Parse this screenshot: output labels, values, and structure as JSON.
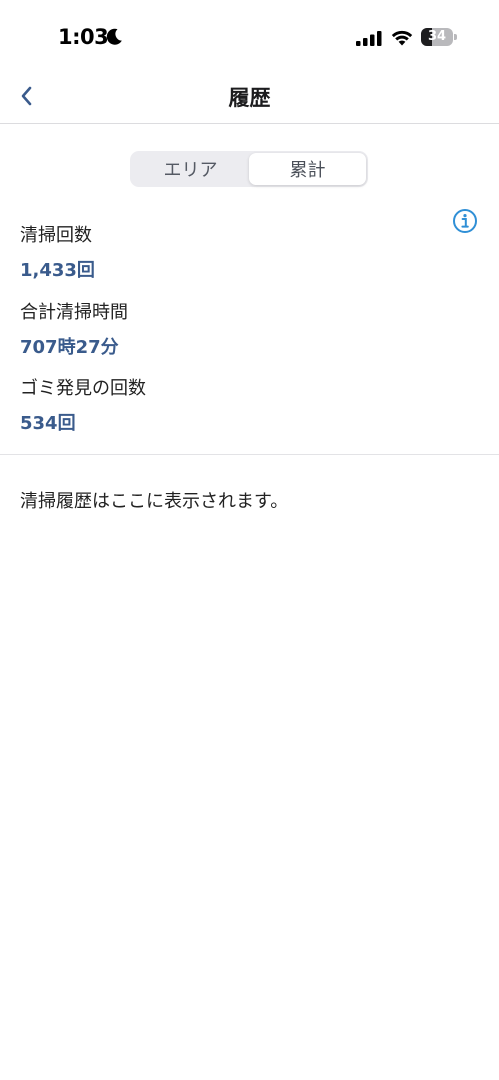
{
  "status_bar": {
    "time": "1:03",
    "battery_level": "34",
    "battery_fraction": 0.34
  },
  "nav": {
    "title": "履歴"
  },
  "segment": {
    "options": [
      "エリア",
      "累計"
    ],
    "selected": "累計"
  },
  "stats": [
    {
      "label": "清掃回数",
      "value": "1,433回"
    },
    {
      "label": "合計清掃時間",
      "value": "707時27分"
    },
    {
      "label": "ゴミ発見の回数",
      "value": "534回"
    }
  ],
  "history": {
    "empty_message": "清掃履歴はここに表示されます。"
  },
  "colors": {
    "accent": "#3a5b8c",
    "info_icon": "#2f8fd6"
  },
  "icons": {
    "back": "chevron-left-icon",
    "info": "info-circle-icon",
    "moon": "moon-icon",
    "signal": "cellular-signal-icon",
    "wifi": "wifi-icon",
    "battery": "battery-icon"
  }
}
